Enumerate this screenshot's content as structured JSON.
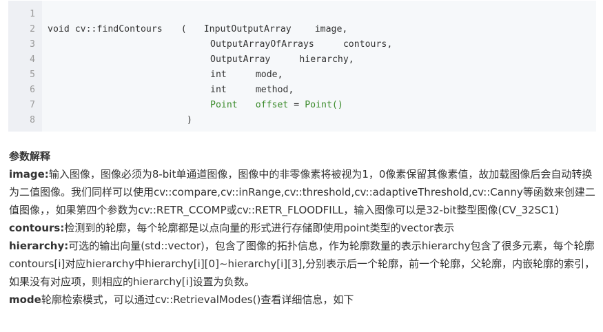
{
  "code": {
    "line_numbers": [
      "1",
      "2",
      "3",
      "4",
      "5",
      "6",
      "7",
      "8"
    ],
    "line2": {
      "prefix": "void cv::findContours",
      "paren": "(",
      "type": "InputOutputArray",
      "name": "image,"
    },
    "line3": {
      "type": "OutputArrayOfArrays",
      "name": "contours,"
    },
    "line4": {
      "type": "OutputArray",
      "name": "hierarchy,"
    },
    "line5": {
      "type": "int",
      "name": "mode,"
    },
    "line6": {
      "type": "int",
      "name": "method,"
    },
    "line7": {
      "type": "Point",
      "name": "offset",
      "eq": "=",
      "default": "Point()"
    },
    "line8": {
      "close": ")"
    }
  },
  "doc": {
    "heading": "参数解释",
    "params": [
      {
        "term": "image:",
        "desc": "输入图像，图像必须为8-bit单通道图像，图像中的非零像素将被视为1，0像素保留其像素值，故加载图像后会自动转换为二值图像。我们同样可以使用cv::compare,cv::inRange,cv::threshold,cv::adaptiveThreshold,cv::Canny等函数来创建二值图像，，如果第四个参数为cv::RETR_CCOMP或cv::RETR_FLOODFILL，输入图像可以是32-bit整型图像(CV_32SC1)"
      },
      {
        "term": "contours:",
        "desc": "检测到的轮廓，每个轮廓都是以点向量的形式进行存储即使用point类型的vector表示"
      },
      {
        "term": "hierarchy:",
        "desc": "可选的输出向量(std::vector)，包含了图像的拓扑信息，作为轮廓数量的表示hierarchy包含了很多元素，每个轮廓contours[i]对应hierarchy中hierarchy[i][0]~hierarchy[i][3],分别表示后一个轮廓，前一个轮廓，父轮廓，内嵌轮廓的索引，如果没有对应项，则相应的hierarchy[i]设置为负数。"
      },
      {
        "term": "mode",
        "desc": "轮廓检索模式，可以通过cv::RetrievalModes()查看详细信息，如下"
      }
    ]
  }
}
